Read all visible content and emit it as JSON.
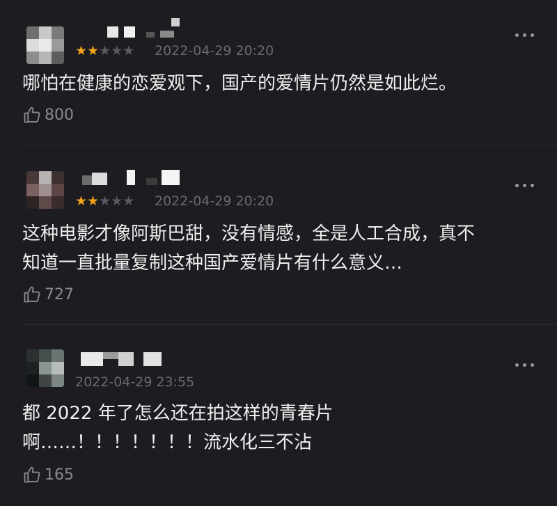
{
  "comments": [
    {
      "rating": 2,
      "stars_text": {
        "on": "★★",
        "off": "★★★"
      },
      "time": "2022-04-29 20:20",
      "text": "哪怕在健康的恋爱观下，国产的爱情片仍然是如此烂。",
      "likes": "800"
    },
    {
      "rating": 2,
      "stars_text": {
        "on": "★★",
        "off": "★★★"
      },
      "time": "2022-04-29 20:20",
      "text": "这种电影才像阿斯巴甜，没有情感，全是人工合成，真不\n知道一直批量复制这种国产爱情片有什么意义…",
      "likes": "727"
    },
    {
      "rating": null,
      "time": "2022-04-29 23:55",
      "text": "都 2022 年了怎么还在拍这样的青春片\n啊……！！！！！！！流水化三不沾",
      "likes": "165"
    }
  ],
  "icons": {
    "like": "thumbs-up-icon",
    "more": "more-dots-icon"
  },
  "colors": {
    "background": "#1d1c21",
    "star_on": "#f2a31b",
    "star_off": "#5a5960",
    "meta": "#6b6a72"
  }
}
